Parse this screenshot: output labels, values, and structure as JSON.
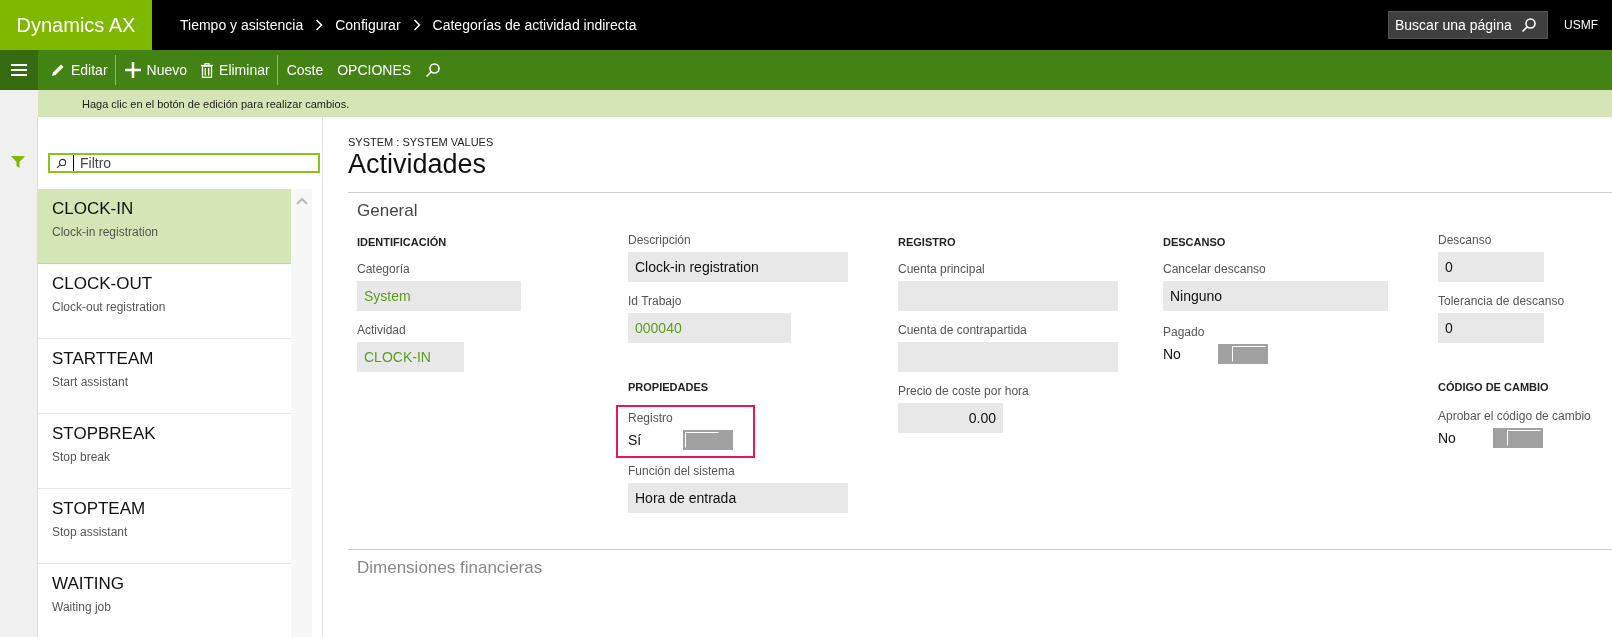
{
  "app": {
    "name": "Dynamics AX"
  },
  "breadcrumb": [
    "Tiempo y asistencia",
    "Configurar",
    "Categorías de actividad indirecta"
  ],
  "page_search": {
    "placeholder": "Buscar una página"
  },
  "company": "USMF",
  "toolbar": [
    {
      "kind": "edit",
      "label": "Editar",
      "separated": true
    },
    {
      "kind": "new",
      "label": "Nuevo",
      "separated": false
    },
    {
      "kind": "delete",
      "label": "Eliminar",
      "separated": true
    },
    {
      "kind": "text",
      "label": "Coste",
      "separated": false
    },
    {
      "kind": "text",
      "label": "OPCIONES",
      "separated": false
    },
    {
      "kind": "search",
      "separated": false
    }
  ],
  "message": "Haga clic en el botón de edición para realizar cambios.",
  "filter": {
    "placeholder": "Filtro"
  },
  "list": [
    {
      "title": "CLOCK-IN",
      "subtitle": "Clock-in registration",
      "selected": true
    },
    {
      "title": "CLOCK-OUT",
      "subtitle": "Clock-out registration",
      "selected": false
    },
    {
      "title": "STARTTEAM",
      "subtitle": "Start assistant",
      "selected": false
    },
    {
      "title": "STOPBREAK",
      "subtitle": "Stop break",
      "selected": false
    },
    {
      "title": "STOPTEAM",
      "subtitle": "Stop assistant",
      "selected": false
    },
    {
      "title": "WAITING",
      "subtitle": "Waiting job",
      "selected": false
    }
  ],
  "form": {
    "caption": "SYSTEM : SYSTEM VALUES",
    "title": "Actividades",
    "sections": [
      {
        "title": "General",
        "expanded": true,
        "columns": [
          [
            {
              "kind": "heading",
              "text": "IDENTIFICACIÓN"
            },
            {
              "kind": "field",
              "label": "Categoría",
              "value": "System",
              "link": true
            },
            {
              "kind": "field",
              "label": "Actividad",
              "value": "CLOCK-IN",
              "link": true
            }
          ],
          [
            {
              "kind": "field",
              "label": "Descripción",
              "value": "Clock-in registration",
              "link": false
            },
            {
              "kind": "field",
              "label": "Id Trabajo",
              "value": "000040",
              "link": true
            },
            {
              "kind": "heading",
              "text": "PROPIEDADES"
            },
            {
              "kind": "toggle",
              "label": "Registro",
              "value": "Sí",
              "on": true,
              "highlighted": true
            },
            {
              "kind": "field",
              "label": "Función del sistema",
              "value": "Hora de entrada",
              "link": false
            }
          ],
          [
            {
              "kind": "heading",
              "text": "REGISTRO"
            },
            {
              "kind": "field",
              "label": "Cuenta principal",
              "link": false
            },
            {
              "kind": "field",
              "label": "Cuenta de contrapartida",
              "link": false
            },
            {
              "kind": "field",
              "label": "Precio de coste por hora",
              "value": "0.00",
              "link": false,
              "numeric": true
            }
          ],
          [
            {
              "kind": "heading",
              "text": "DESCANSO"
            },
            {
              "kind": "field",
              "label": "Cancelar descanso",
              "value": "Ninguno",
              "link": false
            },
            {
              "kind": "toggle",
              "label": "Pagado",
              "value": "No",
              "on": false,
              "highlighted": false
            }
          ],
          [
            {
              "kind": "field",
              "label": "Descanso",
              "value": "0",
              "link": false
            },
            {
              "kind": "field",
              "label": "Tolerancia de descanso",
              "value": "0",
              "link": false
            },
            {
              "kind": "heading",
              "text": "CÓDIGO DE CAMBIO"
            },
            {
              "kind": "toggle",
              "label": "Aprobar el código de cambio",
              "value": "No",
              "on": false,
              "highlighted": false
            }
          ]
        ]
      },
      {
        "title": "Dimensiones financieras",
        "expanded": false
      }
    ]
  }
}
